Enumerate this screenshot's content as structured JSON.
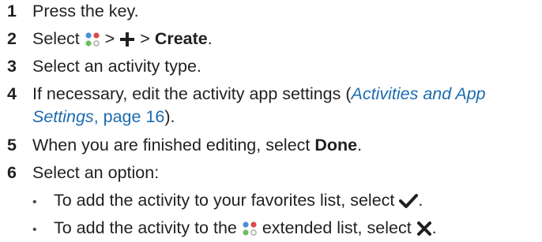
{
  "steps": [
    {
      "num": "1",
      "text": "Press the key."
    },
    {
      "num": "2",
      "prefix": "Select",
      "sep1": ">",
      "sep2": ">",
      "bold": "Create",
      "suffix": "."
    },
    {
      "num": "3",
      "text": "Select an activity type."
    },
    {
      "num": "4",
      "text": "If necessary, edit the activity app settings (",
      "link_part1": "Activities and App",
      "link_part2": "Settings",
      "after_link": ", ",
      "page_ref": "page 16",
      "end": ")."
    },
    {
      "num": "5",
      "text": "When you are finished editing, select ",
      "bold": "Done",
      "suffix": "."
    },
    {
      "num": "6",
      "text": "Select an option:"
    }
  ],
  "bullets": [
    {
      "marker": "•",
      "text": "To add the activity to your favorites list, select",
      "suffix": "."
    },
    {
      "marker": "•",
      "text_before": "To add the activity to the",
      "text_after": "extended list, select",
      "suffix": "."
    }
  ],
  "colors": {
    "text": "#231f20",
    "link": "#1c6bb0",
    "apps_icon": [
      "#4a90d9",
      "#6cbf5f",
      "#d94a4a",
      "#9b9b9b"
    ]
  },
  "icons": [
    "apps-icon",
    "plus-icon",
    "checkmark-icon",
    "x-icon"
  ]
}
